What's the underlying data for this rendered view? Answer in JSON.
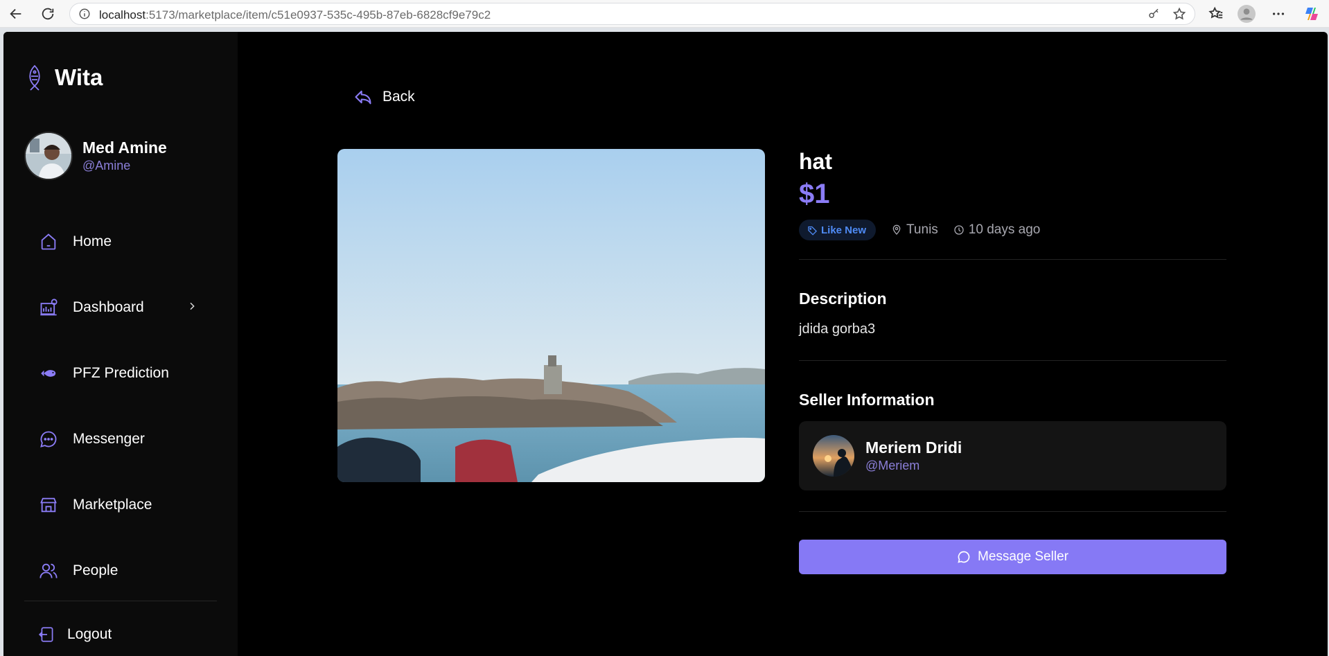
{
  "browser": {
    "url_host": "localhost",
    "url_path": ":5173/marketplace/item/c51e0937-535c-495b-87eb-6828cf9e79c2"
  },
  "sidebar": {
    "brand": "Wita",
    "user": {
      "name": "Med Amine",
      "handle": "@Amine"
    },
    "items": [
      {
        "label": "Home",
        "icon": "home-icon"
      },
      {
        "label": "Dashboard",
        "icon": "dashboard-icon"
      },
      {
        "label": "PFZ Prediction",
        "icon": "fish-icon"
      },
      {
        "label": "Messenger",
        "icon": "chat-icon"
      },
      {
        "label": "Marketplace",
        "icon": "store-icon"
      },
      {
        "label": "People",
        "icon": "people-icon"
      }
    ],
    "logout": "Logout"
  },
  "main": {
    "back_label": "Back",
    "item": {
      "title": "hat",
      "price": "$1",
      "condition": "Like New",
      "location": "Tunis",
      "posted": "10 days ago",
      "description_heading": "Description",
      "description": "jdida gorba3",
      "seller_heading": "Seller Information",
      "seller": {
        "name": "Meriem Dridi",
        "handle": "@Meriem"
      },
      "message_button": "Message Seller"
    }
  },
  "colors": {
    "accent": "#8b7cf6",
    "badge_text": "#4f8bf5",
    "background": "#000000",
    "sidebar": "#0b0b0b"
  }
}
